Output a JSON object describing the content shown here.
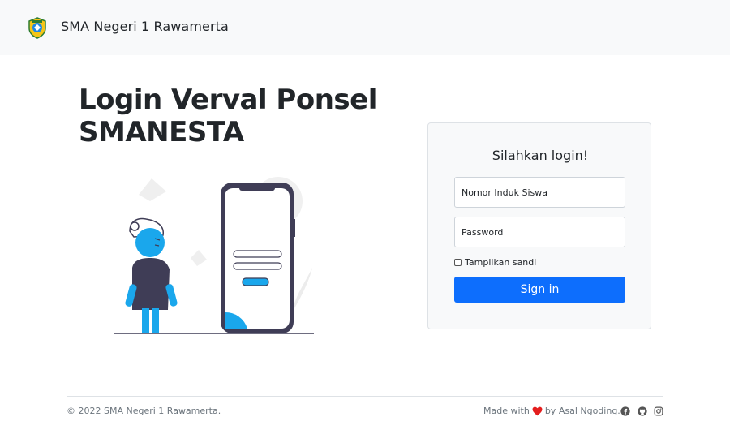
{
  "header": {
    "school_name": "SMA Negeri 1 Rawamerta",
    "logo_icon": "school-crest"
  },
  "main": {
    "title_line1": "Login Verval Ponsel",
    "title_line2": "SMANESTA"
  },
  "login": {
    "heading": "Silahkan login!",
    "nis_placeholder": "Nomor Induk Siswa",
    "password_placeholder": "Password",
    "show_password_label": "Tampilkan sandi",
    "submit_label": "Sign in"
  },
  "footer": {
    "copyright": "© 2022 SMA Negeri 1 Rawamerta.",
    "made_with_prefix": "Made with",
    "made_with_suffix": "by Asal Ngoding.",
    "social_icons": [
      "facebook-icon",
      "github-icon",
      "instagram-icon"
    ]
  },
  "colors": {
    "primary": "#0d6efd",
    "accent_blue": "#1aa7ec",
    "heart": "#e41e1e",
    "navbar_bg": "#f8f9fa"
  }
}
